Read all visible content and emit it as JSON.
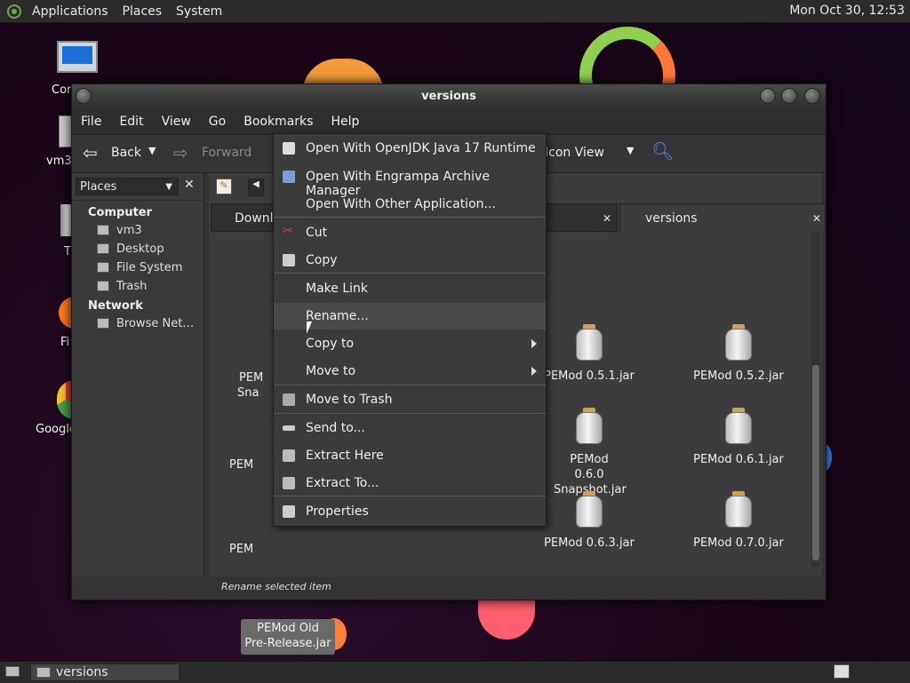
{
  "top_panel": {
    "menus": [
      "Applications",
      "Places",
      "System"
    ],
    "clock": "Mon Oct 30, 12:53"
  },
  "desktop_icons": [
    "Cor",
    "vm3",
    "T",
    "Fi",
    "Google"
  ],
  "window": {
    "title": "versions",
    "menubar": [
      "File",
      "Edit",
      "View",
      "Go",
      "Bookmarks",
      "Help"
    ],
    "toolbar": {
      "back": "Back",
      "forward": "Forward",
      "view_mode": "Icon View"
    },
    "sidebar": {
      "places_label": "Places",
      "computer_heading": "Computer",
      "computer_items": [
        "vm3",
        "Desktop",
        "File System",
        "Trash"
      ],
      "network_heading": "Network",
      "network_items": [
        "Browse Net…"
      ]
    },
    "tabs": [
      "Downlo",
      "versions"
    ],
    "files_hidden": [
      "PEM",
      "Sna",
      "PEM",
      "PEM"
    ],
    "files": [
      {
        "name": "PEMod 0.5.1.jar"
      },
      {
        "name": "PEMod 0.5.2.jar"
      },
      {
        "name": "PEMod 0.6.0 Snapshot.jar"
      },
      {
        "name": "PEMod 0.6.1.jar"
      },
      {
        "name": "PEMod 0.6.3.jar"
      },
      {
        "name": "PEMod 0.7.0.jar"
      }
    ],
    "selected_file": "PEMod Old Pre-Release.jar",
    "status": "Rename selected item"
  },
  "context_menu": {
    "items": [
      "Open With OpenJDK Java 17 Runtime",
      "Open With Engrampa Archive Manager",
      "Open With Other Application...",
      "Cut",
      "Copy",
      "Make Link",
      "Rename...",
      "Copy to",
      "Move to",
      "Move to Trash",
      "Send to...",
      "Extract Here",
      "Extract To...",
      "Properties"
    ],
    "highlighted": "Rename..."
  },
  "taskbar": {
    "window_button": "versions"
  },
  "colors": {
    "panel": "#2b2b2b",
    "window_bg": "#3c3c3c",
    "menu_bg": "#3b3b3b",
    "highlight": "#4a4a4a"
  }
}
